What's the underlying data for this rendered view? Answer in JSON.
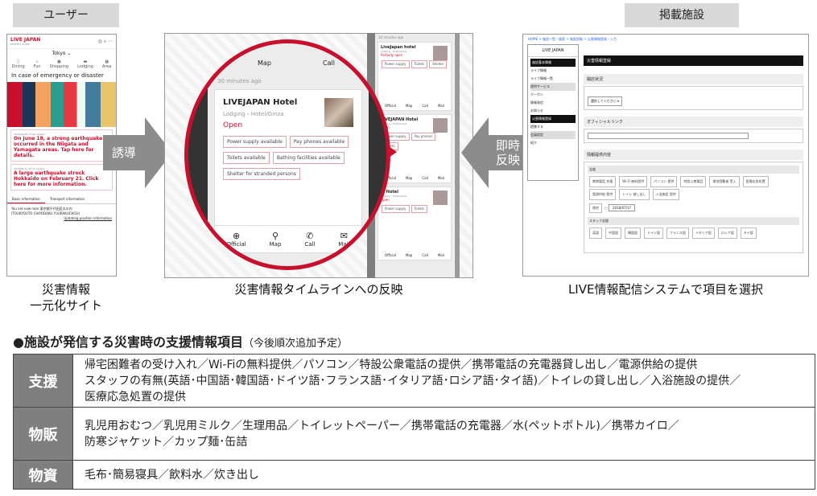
{
  "tags": {
    "left": "ユーザー",
    "right": "掲載施設"
  },
  "captions": {
    "left_l1": "災害情報",
    "left_l2": "一元化サイト",
    "center": "災害情報タイムラインへの反映",
    "right": "LIVE情報配信システムで項目を選択"
  },
  "arrows": {
    "left": "誘導",
    "right_l1": "即時",
    "right_l2": "反映"
  },
  "phone": {
    "logo": "LIVE JAPAN",
    "logo_sub": "PERFECT GUIDE",
    "city": "Tokyo ⌄",
    "nav": [
      "Dining",
      "Fun",
      "Shopping",
      "Lodging",
      "Area"
    ],
    "heading": "In case of emergency or disaster",
    "news1_date": "2018/06/18 11:00 update",
    "news1": "On June 18, a strong earthquake occurred in the Niigata and Yamagata areas. Tap here for details.",
    "news2_date": "2018/02/21 23:10 update",
    "news2": "A large earthquake struck Hokkaido on February 21. Click here for more information.",
    "tab1": "Basic information",
    "tab2": "Transport information",
    "loc": "You are now near 東京都千代田区丸の内",
    "loc2": "(TOUKYOUTO CHIYODAKU YUURAKUCHOU)",
    "update": "Updating position information"
  },
  "zoom": {
    "map_tab": "Map",
    "call_tab": "Call",
    "ago": "30 minutes ago",
    "name": "LIVEJAPAN Hotel",
    "sub": "Lodging・Hotel/Ginza",
    "status": "Open",
    "btns": [
      "Power supply available",
      "Pay phones available",
      "Toilets available",
      "Bathing facilities available",
      "Shelter for stranded persons"
    ],
    "actions": [
      "Official",
      "Map",
      "Call",
      "Mail"
    ]
  },
  "strip": {
    "ago": "30 minutes ago",
    "name1": "LiveJapan hotel",
    "sub1": "Lodging・Hotel/Ginza",
    "status1": "Partially open",
    "name2": "LIVEJAPAN Hotel",
    "sub2": "Lodging・Hotel/Ginza",
    "status2": "Open",
    "name3": "LJ Hotel",
    "sub3": "Lodging・Hotel/Ginza",
    "status3": "Open",
    "acts": [
      "Official",
      "Map",
      "Call",
      "Mail"
    ]
  },
  "cms": {
    "breadcrumb": "HOME > 施設一覧・検索 > 施設詳細 > 災害情報登録・入力",
    "logo": "LIVE JAPAN",
    "title": "災害情報登録",
    "sec1": "開店状況",
    "select": "選択してください ▾",
    "sec2": "オフィシャルリンク",
    "sec3": "情報提供内容",
    "group1": "全般",
    "opts": [
      "携帯電話 充電",
      "Wi-Fi 無料提供",
      "パソコン 提供",
      "特設公衆電話",
      "帰宅困難者 受入",
      "医療応急処置",
      "電源供給 提供",
      "トイレ 貸し出し",
      "入浴施設 提供",
      "帰宅",
      "スタッフ"
    ],
    "group2": "スタッフ支援",
    "langs": [
      "英語",
      "中国語",
      "韓国語",
      "ドイツ語",
      "フランス語",
      "イタリア語",
      "ロシア語",
      "タイ語"
    ],
    "date": "2018/07/17",
    "side": [
      "施設基本情報",
      "ライブ情報",
      "ライブ情報一覧",
      "提供サービス",
      "クーポン",
      "情報発信",
      "お知らせ",
      "災害情報登録",
      "提携する",
      "会員設定",
      "紹介"
    ]
  },
  "section": {
    "bullet": "●",
    "title": "施設が発信する災害時の支援情報項目",
    "note": "（今後順次追加予定）"
  },
  "table": [
    {
      "head": "支援",
      "lines": [
        "帰宅困難者の受け入れ／Wi-Fiの無料提供／パソコン／特設公衆電話の提供／携帯電話の充電器貸し出し／電源供給の提供",
        "スタッフの有無(英語･中国語･韓国語･ドイツ語･フランス語･イタリア語･ロシア語･タイ語)／トイレの貸し出し／入浴施設の提供／",
        "医療応急処置の提供"
      ]
    },
    {
      "head": "物販",
      "lines": [
        "乳児用おむつ／乳児用ミルク／生理用品／トイレットペーパー／携帯電話の充電器／水(ペットボトル)／携帯カイロ／",
        "防寒ジャケット／カップ麺･缶詰"
      ]
    },
    {
      "head": "物資",
      "lines": [
        "毛布･簡易寝具／飲料水／炊き出し"
      ]
    }
  ]
}
